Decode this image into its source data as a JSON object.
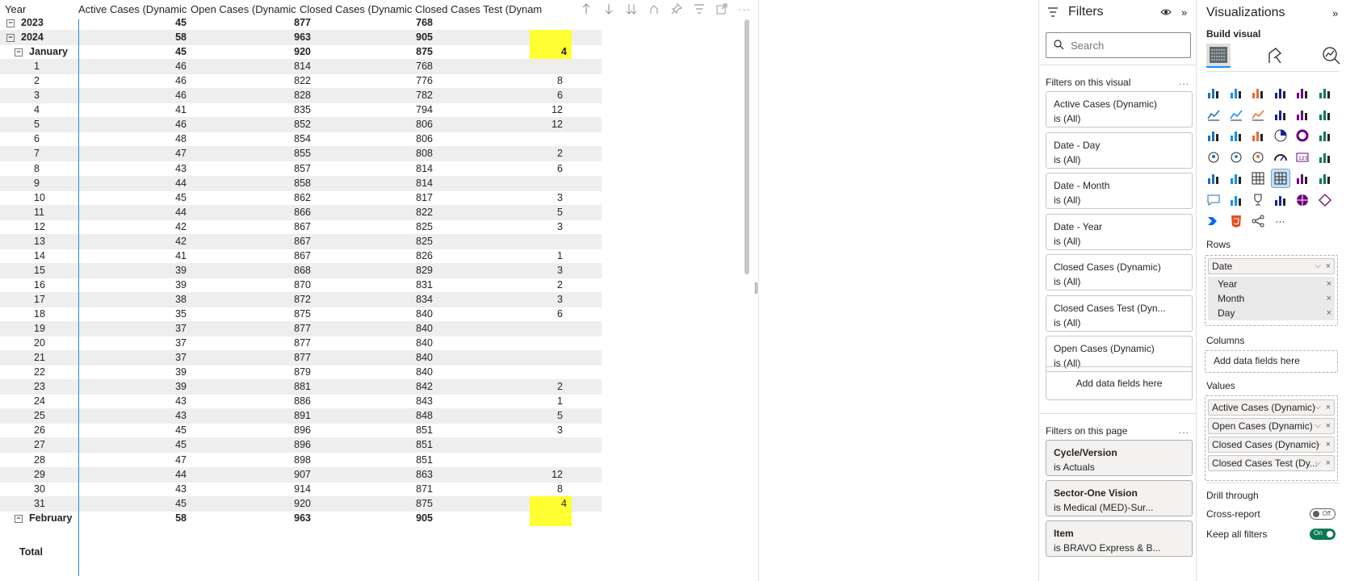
{
  "matrix": {
    "columns": [
      "Year",
      "Active Cases (Dynamic)",
      "Open Cases (Dynamic)",
      "Closed Cases (Dynamic)",
      "Closed Cases Test (Dynamic)"
    ],
    "toolbar_icons": [
      "sort-up-icon",
      "sort-down-icon",
      "expand-all-icon",
      "drill-up-icon",
      "pin-icon",
      "filter-icon",
      "focus-mode-icon",
      "more-options-icon"
    ],
    "rows": [
      {
        "label": "2023",
        "active": "45",
        "open": "877",
        "closed": "768",
        "test": "",
        "level": "year",
        "expander": "⊟",
        "bold": true,
        "highlight": false,
        "cut": true
      },
      {
        "label": "2024",
        "active": "58",
        "open": "963",
        "closed": "905",
        "test": "",
        "level": "year",
        "expander": "⊟",
        "bold": true,
        "highlight": true
      },
      {
        "label": "January",
        "active": "45",
        "open": "920",
        "closed": "875",
        "test": "4",
        "level": "month",
        "expander": "⊟",
        "bold": true,
        "highlight": true
      },
      {
        "label": "1",
        "active": "46",
        "open": "814",
        "closed": "768",
        "test": "",
        "level": "day"
      },
      {
        "label": "2",
        "active": "46",
        "open": "822",
        "closed": "776",
        "test": "8",
        "level": "day"
      },
      {
        "label": "3",
        "active": "46",
        "open": "828",
        "closed": "782",
        "test": "6",
        "level": "day"
      },
      {
        "label": "4",
        "active": "41",
        "open": "835",
        "closed": "794",
        "test": "12",
        "level": "day"
      },
      {
        "label": "5",
        "active": "46",
        "open": "852",
        "closed": "806",
        "test": "12",
        "level": "day"
      },
      {
        "label": "6",
        "active": "48",
        "open": "854",
        "closed": "806",
        "test": "",
        "level": "day"
      },
      {
        "label": "7",
        "active": "47",
        "open": "855",
        "closed": "808",
        "test": "2",
        "level": "day"
      },
      {
        "label": "8",
        "active": "43",
        "open": "857",
        "closed": "814",
        "test": "6",
        "level": "day"
      },
      {
        "label": "9",
        "active": "44",
        "open": "858",
        "closed": "814",
        "test": "",
        "level": "day"
      },
      {
        "label": "10",
        "active": "45",
        "open": "862",
        "closed": "817",
        "test": "3",
        "level": "day"
      },
      {
        "label": "11",
        "active": "44",
        "open": "866",
        "closed": "822",
        "test": "5",
        "level": "day"
      },
      {
        "label": "12",
        "active": "42",
        "open": "867",
        "closed": "825",
        "test": "3",
        "level": "day"
      },
      {
        "label": "13",
        "active": "42",
        "open": "867",
        "closed": "825",
        "test": "",
        "level": "day"
      },
      {
        "label": "14",
        "active": "41",
        "open": "867",
        "closed": "826",
        "test": "1",
        "level": "day"
      },
      {
        "label": "15",
        "active": "39",
        "open": "868",
        "closed": "829",
        "test": "3",
        "level": "day"
      },
      {
        "label": "16",
        "active": "39",
        "open": "870",
        "closed": "831",
        "test": "2",
        "level": "day"
      },
      {
        "label": "17",
        "active": "38",
        "open": "872",
        "closed": "834",
        "test": "3",
        "level": "day"
      },
      {
        "label": "18",
        "active": "35",
        "open": "875",
        "closed": "840",
        "test": "6",
        "level": "day"
      },
      {
        "label": "19",
        "active": "37",
        "open": "877",
        "closed": "840",
        "test": "",
        "level": "day"
      },
      {
        "label": "20",
        "active": "37",
        "open": "877",
        "closed": "840",
        "test": "",
        "level": "day"
      },
      {
        "label": "21",
        "active": "37",
        "open": "877",
        "closed": "840",
        "test": "",
        "level": "day"
      },
      {
        "label": "22",
        "active": "39",
        "open": "879",
        "closed": "840",
        "test": "",
        "level": "day"
      },
      {
        "label": "23",
        "active": "39",
        "open": "881",
        "closed": "842",
        "test": "2",
        "level": "day"
      },
      {
        "label": "24",
        "active": "43",
        "open": "886",
        "closed": "843",
        "test": "1",
        "level": "day"
      },
      {
        "label": "25",
        "active": "43",
        "open": "891",
        "closed": "848",
        "test": "5",
        "level": "day"
      },
      {
        "label": "26",
        "active": "45",
        "open": "896",
        "closed": "851",
        "test": "3",
        "level": "day"
      },
      {
        "label": "27",
        "active": "45",
        "open": "896",
        "closed": "851",
        "test": "",
        "level": "day"
      },
      {
        "label": "28",
        "active": "47",
        "open": "898",
        "closed": "851",
        "test": "",
        "level": "day"
      },
      {
        "label": "29",
        "active": "44",
        "open": "907",
        "closed": "863",
        "test": "12",
        "level": "day"
      },
      {
        "label": "30",
        "active": "43",
        "open": "914",
        "closed": "871",
        "test": "8",
        "level": "day"
      },
      {
        "label": "31",
        "active": "45",
        "open": "920",
        "closed": "875",
        "test": "4",
        "level": "day",
        "highlight": true
      },
      {
        "label": "February",
        "active": "58",
        "open": "963",
        "closed": "905",
        "test": "",
        "level": "month",
        "expander": "⊟",
        "bold": true,
        "highlight": true
      },
      {
        "label": "Total",
        "active": "",
        "open": "",
        "closed": "",
        "test": "",
        "level": "total",
        "bold": true
      }
    ],
    "highlight_color": "#ffff33",
    "divider_color": "#2a8adf"
  },
  "filters": {
    "title": "Filters",
    "search_placeholder": "Search",
    "on_visual_label": "Filters on this visual",
    "on_page_label": "Filters on this page",
    "more": "...",
    "visual_cards": [
      {
        "name": "Active Cases (Dynamic)",
        "value": "is (All)"
      },
      {
        "name": "Date - Day",
        "value": "is (All)"
      },
      {
        "name": "Date - Month",
        "value": "is (All)"
      },
      {
        "name": "Date - Year",
        "value": "is (All)"
      },
      {
        "name": "Closed Cases (Dynamic)",
        "value": "is (All)"
      },
      {
        "name": "Closed Cases Test (Dyn...",
        "value": "is (All)"
      },
      {
        "name": "Open Cases (Dynamic)",
        "value": "is (All)"
      }
    ],
    "add_fields": "Add data fields here",
    "page_cards": [
      {
        "name": "Cycle/Version",
        "value": "is Actuals"
      },
      {
        "name": "Sector-One Vision",
        "value": "is Medical (MED)-Sur..."
      },
      {
        "name": "Item",
        "value": "is BRAVO Express & B..."
      }
    ]
  },
  "visualizations": {
    "title": "Visualizations",
    "build_visual": "Build visual",
    "rows_label": "Rows",
    "rows_field": "Date",
    "rows_subfields": [
      "Year",
      "Month",
      "Day"
    ],
    "columns_label": "Columns",
    "columns_add": "Add data fields here",
    "values_label": "Values",
    "values_fields": [
      "Active Cases (Dynamic)",
      "Open Cases (Dynamic)",
      "Closed Cases (Dynamic)",
      "Closed Cases Test (Dy..."
    ],
    "drill_through": "Drill through",
    "cross_report": "Cross-report",
    "cross_report_state": "Off",
    "keep_all_filters": "Keep all filters",
    "keep_all_filters_state": "On",
    "more_visuals": "...",
    "accent_color": "#118dff"
  }
}
